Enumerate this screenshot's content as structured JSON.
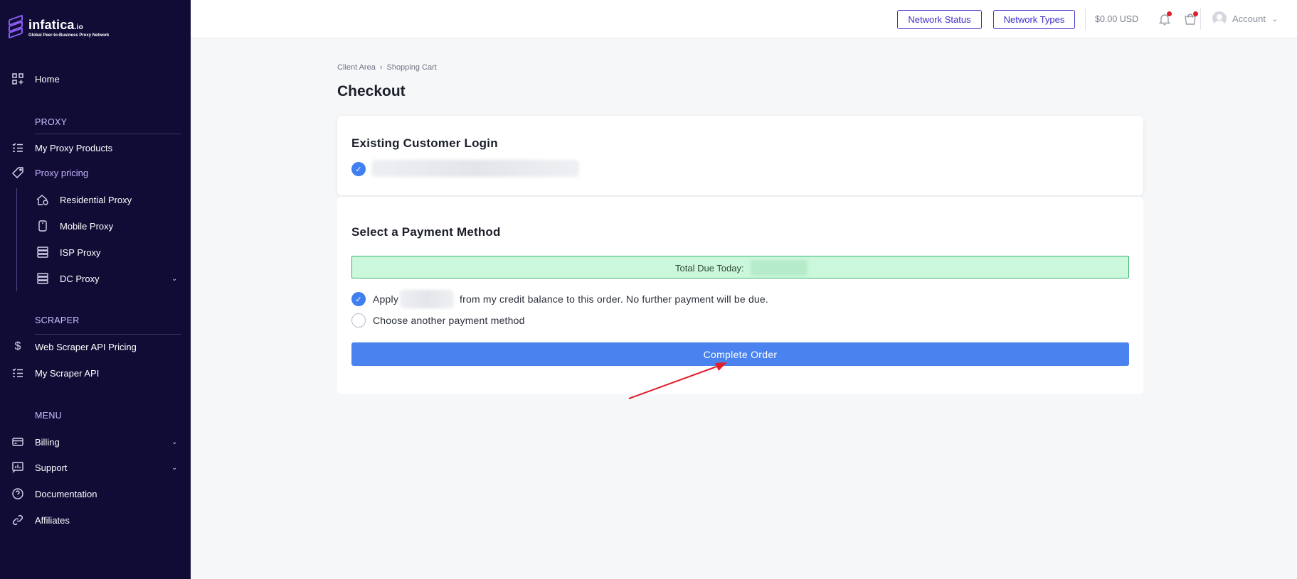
{
  "brand": {
    "name": "infatica",
    "suffix": ".io",
    "tagline": "Global Peer-to-Business Proxy Network"
  },
  "sidebar": {
    "home": "Home",
    "proxy_section": "PROXY",
    "proxy_items": [
      {
        "label": "My Proxy Products",
        "icon": "list-icon"
      },
      {
        "label": "Proxy pricing",
        "icon": "tag-icon"
      }
    ],
    "proxy_subitems": [
      {
        "label": "Residential Proxy",
        "icon": "house-icon"
      },
      {
        "label": "Mobile Proxy",
        "icon": "mobile-icon"
      },
      {
        "label": "ISP Proxy",
        "icon": "server-icon"
      },
      {
        "label": "DC Proxy",
        "icon": "server-icon"
      }
    ],
    "scraper_section": "SCRAPER",
    "scraper_items": [
      {
        "label": "Web Scraper API Pricing",
        "icon": "dollar-icon"
      },
      {
        "label": "My Scraper API",
        "icon": "list-icon"
      }
    ],
    "menu_section": "MENU",
    "menu_items": [
      {
        "label": "Billing",
        "icon": "card-icon"
      },
      {
        "label": "Support",
        "icon": "support-icon"
      },
      {
        "label": "Documentation",
        "icon": "question-icon"
      },
      {
        "label": "Affiliates",
        "icon": "link-icon"
      }
    ]
  },
  "header": {
    "network_status": "Network Status",
    "network_types": "Network Types",
    "balance": "$0.00 USD",
    "account": "Account"
  },
  "breadcrumb": {
    "items": [
      "Client Area",
      "Shopping Cart"
    ]
  },
  "page": {
    "title": "Checkout"
  },
  "login_card": {
    "title": "Existing Customer Login"
  },
  "payment_card": {
    "title": "Select a Payment Method",
    "total_label": "Total Due Today:",
    "option_apply_prefix": "Apply",
    "option_apply_suffix": "from my credit balance to this order. No further payment will be due.",
    "option_other": "Choose another payment method",
    "complete_button": "Complete Order"
  },
  "colors": {
    "sidebar_bg": "#110c36",
    "accent": "#3b2fc9",
    "button_blue": "#4a83f0",
    "success_bg": "#cbf7dc",
    "annotation_arrow": "#e0202c"
  }
}
